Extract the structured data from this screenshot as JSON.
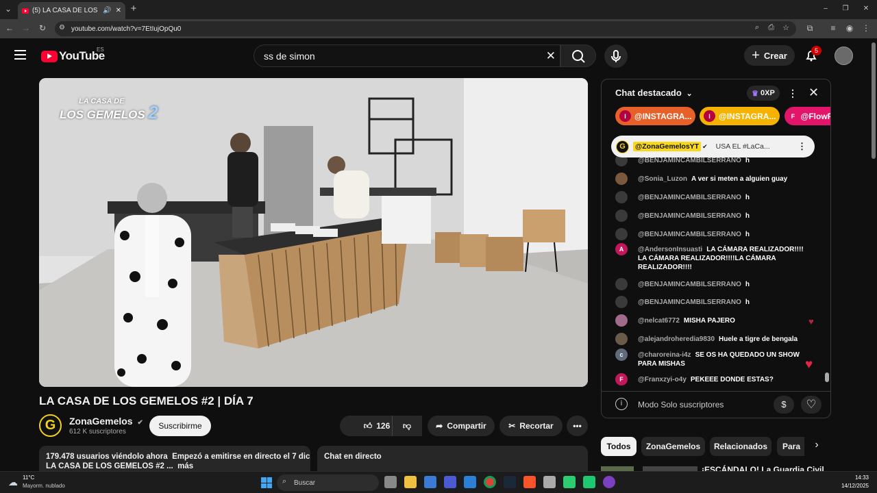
{
  "browser": {
    "tab_title": "(5) LA CASA DE LOS GEMELOS",
    "url": "youtube.com/watch?v=7EtIujOpQu0"
  },
  "youtube": {
    "logo": "YouTube",
    "region": "ES",
    "search_value": "ss de simon",
    "create_label": "Crear",
    "notifications_count": "5"
  },
  "video": {
    "title": "LA CASA DE LOS GEMELOS #2 | DÍA 7",
    "overlay_logo_line1": "LA CASA DE",
    "overlay_logo_line2": "LOS GEMELOS",
    "overlay_logo_num": "2"
  },
  "channel": {
    "name": "ZonaGemelos",
    "subscribers": "612 K suscriptores",
    "subscribe_label": "Suscribirme"
  },
  "actions": {
    "likes": "126 K",
    "share": "Compartir",
    "clip": "Recortar"
  },
  "description": {
    "viewers": "179.478 usuarios viéndolo ahora",
    "started": "Empezó a emitirse en directo el 7 dic",
    "line2": "LA CASA DE LOS GEMELOS #2 ...",
    "more": "más"
  },
  "livechat_box": {
    "title": "Chat en directo"
  },
  "chat": {
    "header": "Chat destacado",
    "xp": "0XP",
    "ticker": [
      {
        "initial": "I",
        "label": "@INSTAGRA...",
        "color": "#e6612a"
      },
      {
        "initial": "I",
        "label": "@INSTAGRA...",
        "color": "#f5b300"
      },
      {
        "initial": "F",
        "label": "@FlowF",
        "color": "#e3156b"
      }
    ],
    "pinned": {
      "author": "@ZonaGemelosYT",
      "text": "USA EL #LaCa..."
    },
    "messages": [
      {
        "author": "@BENJAMINCAMBILSERRANO",
        "text": "h",
        "avatar_color": "#3a3a3a",
        "initial": ""
      },
      {
        "author": "@Sonia_Luzon",
        "text": "A ver si meten a alguien guay",
        "avatar_color": "#7a5a3a",
        "initial": ""
      },
      {
        "author": "@BENJAMINCAMBILSERRANO",
        "text": "h",
        "avatar_color": "#3a3a3a",
        "initial": ""
      },
      {
        "author": "@BENJAMINCAMBILSERRANO",
        "text": "h",
        "avatar_color": "#3a3a3a",
        "initial": ""
      },
      {
        "author": "@BENJAMINCAMBILSERRANO",
        "text": "h",
        "avatar_color": "#3a3a3a",
        "initial": ""
      },
      {
        "author": "@AndersonInsuasti",
        "text": "LA CÁMARA REALIZADOR!!!! LA CÁMARA REALIZADOR!!!!LA CÁMARA REALIZADOR!!!!",
        "avatar_color": "#c2185b",
        "initial": "A"
      },
      {
        "author": "@BENJAMINCAMBILSERRANO",
        "text": "h",
        "avatar_color": "#3a3a3a",
        "initial": ""
      },
      {
        "author": "@BENJAMINCAMBILSERRANO",
        "text": "h",
        "avatar_color": "#3a3a3a",
        "initial": ""
      },
      {
        "author": "@nelcat6772",
        "text": "MISHA PAJERO",
        "avatar_color": "#a06a8a",
        "initial": ""
      },
      {
        "author": "@alejandroheredia9830",
        "text": "Huele a tigre de bengala",
        "avatar_color": "#6a5a4a",
        "initial": ""
      },
      {
        "author": "@charoreina-i4z",
        "text": "SE OS HA QUEDADO UN SHOW PARA MISHAS",
        "avatar_color": "#5f6b7a",
        "initial": "c"
      },
      {
        "author": "@Franxzyi-o4y",
        "text": "PEKEEE DONDE ESTAS?",
        "avatar_color": "#c2185b",
        "initial": "F"
      }
    ],
    "footer": "Modo Solo suscriptores"
  },
  "chips": [
    "Todos",
    "ZonaGemelos",
    "Relacionados",
    "Para"
  ],
  "related_partial_title": "¡ESCÁNDALO! La Guardia Civil",
  "taskbar": {
    "temp": "11°C",
    "weather": "Mayorm. nublado",
    "search": "Buscar",
    "time": "14:33",
    "date": "14/12/2025"
  },
  "colors": {
    "yt_red": "#ff0033",
    "accent_yellow": "#f8d71c",
    "like_red": "#e0244a"
  }
}
